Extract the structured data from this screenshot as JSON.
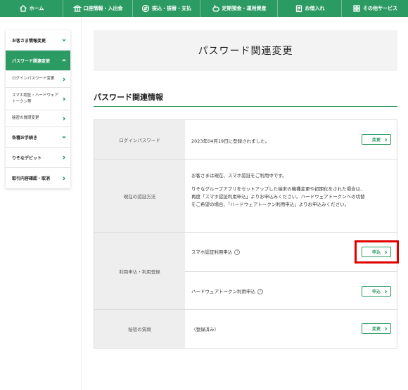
{
  "nav": {
    "items": [
      {
        "label": "ホーム",
        "icon": "home-icon"
      },
      {
        "label": "口座情報・入出金",
        "icon": "bank-icon"
      },
      {
        "label": "振込・振替・支払",
        "icon": "transfer-icon"
      },
      {
        "label": "定期預金・運用資産",
        "icon": "piggy-bank-icon"
      },
      {
        "label": "お借入れ",
        "icon": "loan-icon"
      },
      {
        "label": "その他サービス",
        "icon": "grid-icon"
      }
    ]
  },
  "sidebar": {
    "items": [
      {
        "label": "お客さま情報変更"
      },
      {
        "label": "パスワード関連変更"
      },
      {
        "label": "ログインパスワード変更"
      },
      {
        "label": "スマホ認証・ハードウェアトークン等"
      },
      {
        "label": "秘密の質問変更"
      },
      {
        "label": "各種お手続き"
      },
      {
        "label": "りそなデビット"
      },
      {
        "label": "取引内容確認・取消"
      }
    ]
  },
  "main": {
    "page_title": "パスワード関連変更",
    "section_title": "パスワード関連情報",
    "rows": {
      "login_password": {
        "label": "ログインパスワード",
        "value": "2023年04月19日に登録されました。",
        "button": "変更"
      },
      "auth_method": {
        "label": "現在の認証方法",
        "line1": "お客さまは現在、スマホ認証をご利用中です。",
        "line2": "りそなグループアプリをセットアップした端末の機種変更や初期化をされた場合は、",
        "line3": "再度「スマホ認証利用申込」よりお申込みください。ハードウェアトークンへの切替",
        "line4": "をご希望の場合、「ハードウェアトークン利用申込」よりお申込みください。"
      },
      "usage": {
        "label": "利用申込・利用登録",
        "smartphone": "スマホ認証利用申込",
        "hardware": "ハードウェアトークン利用申込",
        "apply_button": "申込",
        "help": "?"
      },
      "secret_question": {
        "label": "秘密の質問",
        "value": "（登録済み）",
        "button": "変更"
      }
    }
  },
  "colors": {
    "brand": "#2c9b63",
    "highlight": "#e00000"
  }
}
